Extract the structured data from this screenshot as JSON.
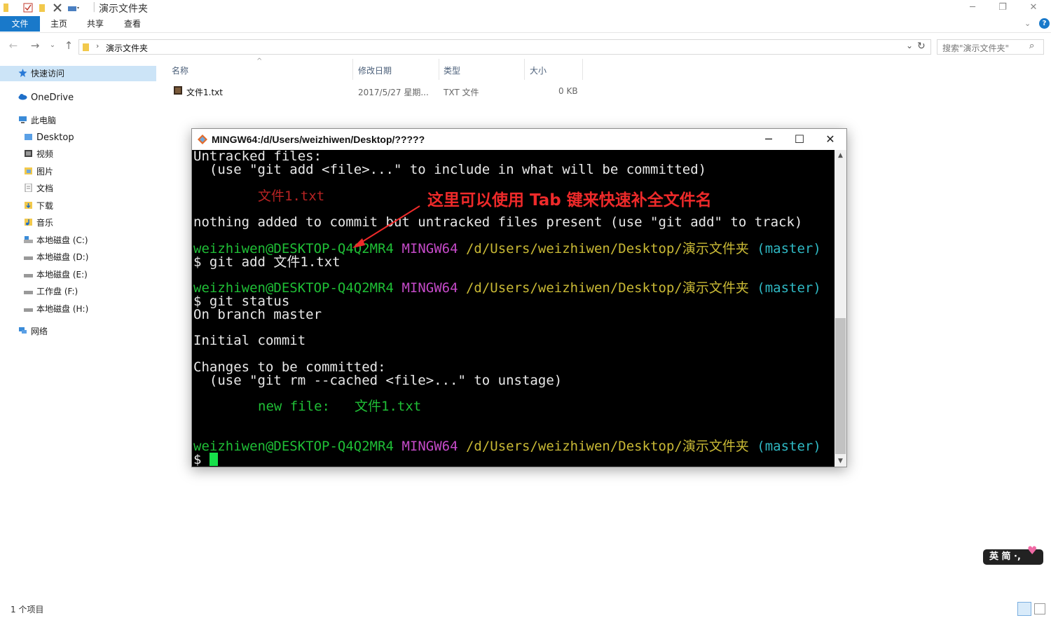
{
  "window": {
    "title": "演示文件夹",
    "controls": {
      "minimize": "─",
      "restore": "❐",
      "close": "✕"
    }
  },
  "ribbon": {
    "tabs": [
      {
        "label": "文件",
        "active": true
      },
      {
        "label": "主页"
      },
      {
        "label": "共享"
      },
      {
        "label": "查看"
      }
    ]
  },
  "address": {
    "path": "演示文件夹",
    "search_placeholder": "搜索\"演示文件夹\""
  },
  "sidebar": {
    "items": [
      {
        "label": "快速访问",
        "icon": "star-icon"
      },
      {
        "label": "OneDrive",
        "icon": "cloud-icon"
      },
      {
        "label": "此电脑",
        "icon": "computer-icon"
      },
      {
        "label": "Desktop",
        "icon": "folder-icon"
      },
      {
        "label": "视频",
        "icon": "video-folder-icon"
      },
      {
        "label": "图片",
        "icon": "pictures-folder-icon"
      },
      {
        "label": "文档",
        "icon": "documents-folder-icon"
      },
      {
        "label": "下载",
        "icon": "downloads-folder-icon"
      },
      {
        "label": "音乐",
        "icon": "music-folder-icon"
      },
      {
        "label": "本地磁盘 (C:)",
        "icon": "drive-icon"
      },
      {
        "label": "本地磁盘 (D:)",
        "icon": "drive-icon"
      },
      {
        "label": "本地磁盘 (E:)",
        "icon": "drive-icon"
      },
      {
        "label": "工作盘 (F:)",
        "icon": "drive-icon"
      },
      {
        "label": "本地磁盘 (H:)",
        "icon": "drive-icon"
      },
      {
        "label": "网络",
        "icon": "network-icon"
      }
    ]
  },
  "filelist": {
    "columns": [
      "名称",
      "修改日期",
      "类型",
      "大小"
    ],
    "rows": [
      {
        "name": "文件1.txt",
        "date": "2017/5/27 星期...",
        "type": "TXT 文件",
        "size": "0 KB"
      }
    ]
  },
  "terminal": {
    "title": "MINGW64:/d/Users/weizhiwen/Desktop/?????",
    "lines": {
      "l1": "Untracked files:",
      "l2": "  (use \"git add <file>...\" to include in what will be committed)",
      "l3": "文件1.txt",
      "l4": "nothing added to commit but untracked files present (use \"git add\" to track)",
      "user": "weizhiwen@DESKTOP-Q4Q2MR4",
      "mingw": "MINGW64",
      "cwd": "/d/Users/weizhiwen/Desktop/演示文件夹",
      "branch": "(master)",
      "cmd1": "$ git add 文件1.txt",
      "cmd2": "$ git status",
      "on_branch": "On branch master",
      "initial": "Initial commit",
      "changes": "Changes to be committed:",
      "unstage": "  (use \"git rm --cached <file>...\" to unstage)",
      "newfile_label": "new file:",
      "newfile_name": "文件1.txt",
      "prompt": "$ "
    }
  },
  "annotation": {
    "text": "这里可以使用 Tab 键来快速补全文件名",
    "color": "#ee2a2a"
  },
  "status": {
    "count": "1 个项目"
  },
  "ime": {
    "text": "英 简 ·,"
  }
}
